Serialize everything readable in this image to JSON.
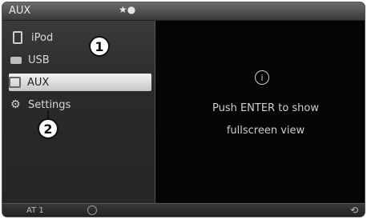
{
  "header": {
    "title": "AUX",
    "status": "★●"
  },
  "menu": {
    "items": [
      {
        "label": "iPod",
        "icon": "ipod-icon"
      },
      {
        "label": "USB",
        "icon": "usb-icon"
      },
      {
        "label": "AUX",
        "icon": "aux-icon",
        "selected": true
      },
      {
        "label": "Settings",
        "icon": "gear-icon"
      }
    ]
  },
  "content": {
    "info_icon": "i",
    "line1": "Push ENTER to show",
    "line2": "fullscreen view"
  },
  "callouts": {
    "one": "1",
    "two": "2"
  },
  "footer": {
    "track": "AT 1",
    "back_icon": "back-icon"
  }
}
